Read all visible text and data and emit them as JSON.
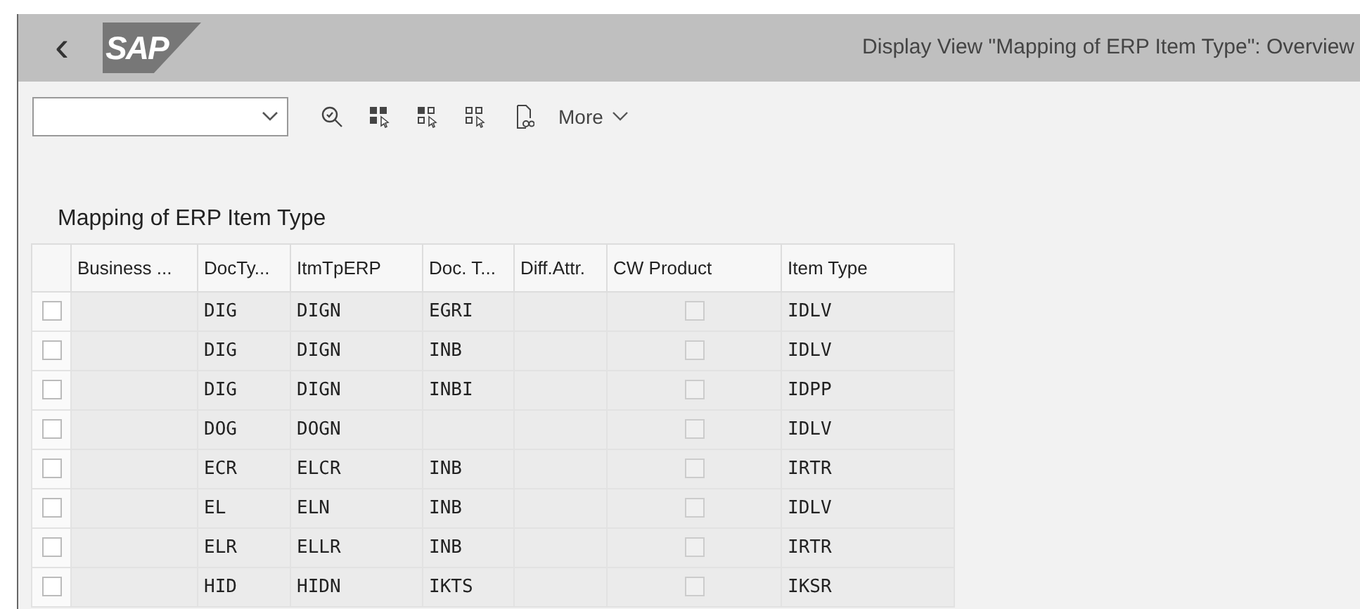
{
  "header": {
    "back": "‹",
    "logo": "SAP",
    "title": "Display View \"Mapping of ERP Item Type\": Overview"
  },
  "toolbar": {
    "more": "More"
  },
  "section_title": "Mapping of ERP Item Type",
  "table": {
    "columns": [
      "Business ...",
      "DocTy...",
      "ItmTpERP",
      "Doc. T...",
      "Diff.Attr.",
      "CW Product",
      "Item Type"
    ],
    "rows": [
      {
        "selected": false,
        "cells": [
          "",
          "DIG",
          "DIGN",
          "EGRI",
          ""
        ],
        "cw_product": false,
        "item_type": "IDLV"
      },
      {
        "selected": false,
        "cells": [
          "",
          "DIG",
          "DIGN",
          "INB",
          ""
        ],
        "cw_product": false,
        "item_type": "IDLV"
      },
      {
        "selected": false,
        "cells": [
          "",
          "DIG",
          "DIGN",
          "INBI",
          ""
        ],
        "cw_product": false,
        "item_type": "IDPP"
      },
      {
        "selected": false,
        "cells": [
          "",
          "DOG",
          "DOGN",
          "",
          ""
        ],
        "cw_product": false,
        "item_type": "IDLV"
      },
      {
        "selected": false,
        "cells": [
          "",
          "ECR",
          "ELCR",
          "INB",
          ""
        ],
        "cw_product": false,
        "item_type": "IRTR"
      },
      {
        "selected": false,
        "cells": [
          "",
          "EL",
          "ELN",
          "INB",
          ""
        ],
        "cw_product": false,
        "item_type": "IDLV"
      },
      {
        "selected": false,
        "cells": [
          "",
          "ELR",
          "ELLR",
          "INB",
          ""
        ],
        "cw_product": false,
        "item_type": "IRTR"
      },
      {
        "selected": false,
        "cells": [
          "",
          "HID",
          "HIDN",
          "IKTS",
          ""
        ],
        "cw_product": false,
        "item_type": "IKSR"
      }
    ]
  }
}
